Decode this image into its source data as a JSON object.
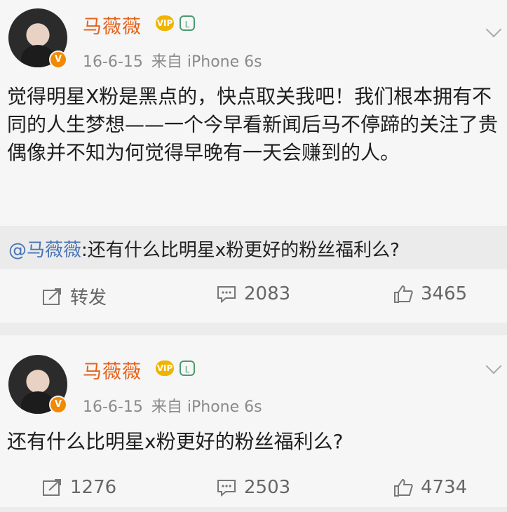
{
  "posts": [
    {
      "author": "马薇薇",
      "timestamp": "16-6-15",
      "source": "来自 iPhone 6s",
      "text": "觉得明星X粉是黑点的，快点取关我吧！我们根本拥有不同的人生梦想——一个今早看新闻后马不停蹄的关注了贵偶像并不知为何觉得早晚有一天会赚到的人。",
      "repost": {
        "mention": "@马薇薇",
        "text": ":还有什么比明星x粉更好的粉丝福利么?"
      },
      "actions": {
        "share": "转发",
        "comments": "2083",
        "likes": "3465"
      }
    },
    {
      "author": "马薇薇",
      "timestamp": "16-6-15",
      "source": "来自 iPhone 6s",
      "text": "还有什么比明星x粉更好的粉丝福利么?",
      "actions": {
        "share": "1276",
        "comments": "2503",
        "likes": "4734"
      }
    }
  ],
  "colors": {
    "name": "#e4631c",
    "mention": "#4a74b5",
    "vip": "#f0b400"
  },
  "icons": [
    "avatar",
    "verified-badge",
    "vip-crown-icon",
    "level-badge-icon",
    "chevron-down-icon",
    "share-icon",
    "comment-icon",
    "like-icon"
  ]
}
